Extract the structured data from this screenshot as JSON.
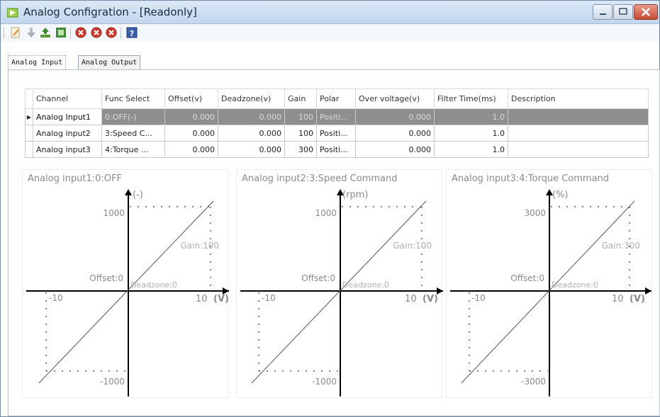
{
  "window": {
    "title": "Analog Configration - [Readonly]"
  },
  "toolbar": {
    "buttons": [
      {
        "name": "edit-icon"
      },
      {
        "name": "download-icon"
      },
      {
        "name": "upload-icon"
      },
      {
        "name": "export-icon"
      },
      {
        "name": "stop-icon-1"
      },
      {
        "name": "stop-icon-2"
      },
      {
        "name": "stop-icon-3"
      },
      {
        "name": "help-icon"
      }
    ]
  },
  "tabs": {
    "input": "Analog Input",
    "output": "Analog Output"
  },
  "table": {
    "headers": [
      "Channel",
      "Func Select",
      "Offset(v)",
      "Deadzone(v)",
      "Gain",
      "Polar",
      "Over voltage(v)",
      "Filter Time(ms)",
      "Description"
    ],
    "rows": [
      [
        "Analog Input1",
        "0:OFF(-)",
        "0.000",
        "0.000",
        "100",
        "Positi...",
        "0.000",
        "1.0",
        ""
      ],
      [
        "Analog input2",
        "3:Speed C...",
        "0.000",
        "0.000",
        "100",
        "Positi...",
        "0.000",
        "1.0",
        ""
      ],
      [
        "Analog input3",
        "4:Torque ...",
        "0.000",
        "0.000",
        "300",
        "Positi...",
        "0.000",
        "1.0",
        ""
      ]
    ]
  },
  "charts": [
    {
      "title": "Analog input1:0:OFF",
      "unit": "(-)",
      "ymax": "1000",
      "ymin": "-1000",
      "xmin": "-10",
      "xmax": "10",
      "xunit": "(V)",
      "gain": "Gain:100",
      "offset": "Offset:0",
      "deadzone": "Deadzone:0"
    },
    {
      "title": "Analog input2:3:Speed Command",
      "unit": "(rpm)",
      "ymax": "1000",
      "ymin": "-1000",
      "xmin": "-10",
      "xmax": "10",
      "xunit": "(V)",
      "gain": "Gain:100",
      "offset": "Offset:0",
      "deadzone": "Deadzone:0"
    },
    {
      "title": "Analog input3:4:Torque Command",
      "unit": "(%)",
      "ymax": "3000",
      "ymin": "-3000",
      "xmin": "-10",
      "xmax": "10",
      "xunit": "(V)",
      "gain": "Gain:300",
      "offset": "Offset:0",
      "deadzone": "Deadzone:0"
    }
  ]
}
